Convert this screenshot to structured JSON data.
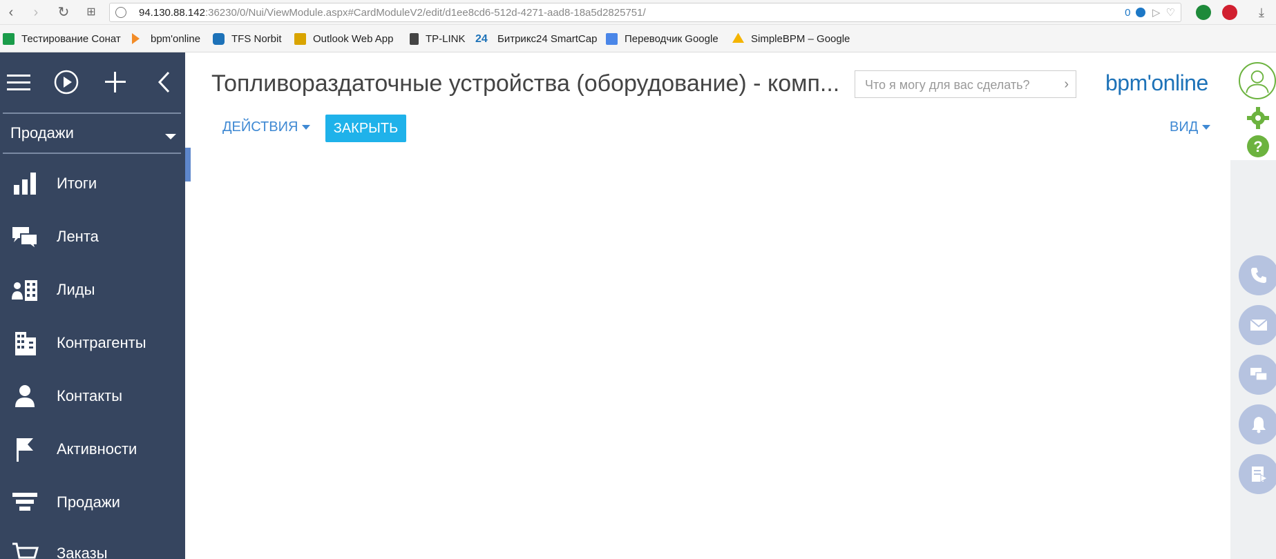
{
  "browser": {
    "url_host": "94.130.88.142",
    "url_rest": ":36230/0/Nui/ViewModule.aspx#CardModuleV2/edit/d1ee8cd6-512d-4271-aad8-18a5d2825751/",
    "badge_count": "0"
  },
  "bookmarks": [
    {
      "label": "Тестирование Сонат",
      "icon": "sheets-icon",
      "color": "#1a9c4a"
    },
    {
      "label": "bpm'online",
      "icon": "play-icon",
      "color": "#f28c28"
    },
    {
      "label": "TFS Norbit",
      "icon": "vs-icon",
      "color": "#1d72b8"
    },
    {
      "label": "Outlook Web App",
      "icon": "outlook-icon",
      "color": "#d9a400"
    },
    {
      "label": "TP-LINK",
      "icon": "file-icon",
      "color": "#444444"
    },
    {
      "label": "Битрикс24 SmartCap",
      "icon": "bitrix-icon",
      "color": "#1d72b8"
    },
    {
      "label": "Переводчик Google",
      "icon": "translate-icon",
      "color": "#4a86e8"
    },
    {
      "label": "SimpleBPM – Google",
      "icon": "drive-icon",
      "color": "#f4b400"
    }
  ],
  "sidebar": {
    "section": "Продажи",
    "items": [
      {
        "label": "Итоги",
        "icon": "bar-chart-icon"
      },
      {
        "label": "Лента",
        "icon": "chat-icon"
      },
      {
        "label": "Лиды",
        "icon": "leads-icon"
      },
      {
        "label": "Контрагенты",
        "icon": "building-icon"
      },
      {
        "label": "Контакты",
        "icon": "person-icon"
      },
      {
        "label": "Активности",
        "icon": "flag-icon"
      },
      {
        "label": "Продажи",
        "icon": "funnel-icon"
      },
      {
        "label": "Заказы",
        "icon": "cart-icon"
      }
    ]
  },
  "main": {
    "title": "Топливораздаточные устройства (оборудование) - комп...",
    "search_placeholder": "Что я могу для вас сделать?",
    "logo": "bpm'online",
    "actions_label": "ДЕЙСТВИЯ",
    "close_label": "ЗАКРЫТЬ",
    "view_label": "ВИД"
  },
  "colors": {
    "sidebar_bg": "#36455f",
    "accent_blue": "#3f89d3",
    "close_button": "#1fb2ea",
    "right_buttons": "#b6c3e0",
    "green": "#6cb33f"
  }
}
